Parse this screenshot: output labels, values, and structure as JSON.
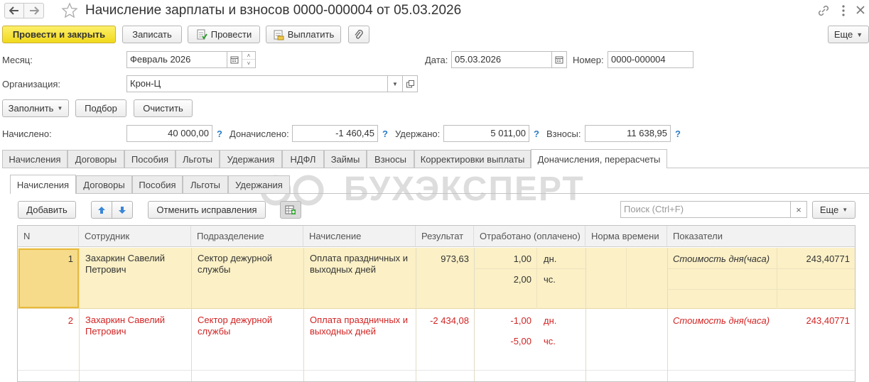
{
  "window": {
    "title": "Начисление зарплаты и взносов 0000-000004 от 05.03.2026",
    "icons": [
      "back-arrow-icon",
      "forward-arrow-icon",
      "star-icon",
      "link-icon",
      "menu-icon",
      "close-icon"
    ]
  },
  "toolbar": {
    "post_close": "Провести и закрыть",
    "save": "Записать",
    "post": "Провести",
    "pay": "Выплатить",
    "more": "Еще"
  },
  "form": {
    "month_label": "Месяц:",
    "month_value": "Февраль 2026",
    "date_label": "Дата:",
    "date_value": "05.03.2026",
    "number_label": "Номер:",
    "number_value": "0000-000004",
    "org_label": "Организация:",
    "org_value": "Крон-Ц",
    "fill": "Заполнить",
    "pick": "Подбор",
    "clear": "Очистить"
  },
  "totals": {
    "accrued_label": "Начислено:",
    "accrued_value": "40 000,00",
    "additional_label": "Доначислено:",
    "additional_value": "-1 460,45",
    "withheld_label": "Удержано:",
    "withheld_value": "5 011,00",
    "contrib_label": "Взносы:",
    "contrib_value": "11 638,95",
    "help": "?"
  },
  "tabs": [
    "Начисления",
    "Договоры",
    "Пособия",
    "Льготы",
    "Удержания",
    "НДФЛ",
    "Займы",
    "Взносы",
    "Корректировки выплаты",
    "Доначисления, перерасчеты"
  ],
  "subtabs": [
    "Начисления",
    "Договоры",
    "Пособия",
    "Льготы",
    "Удержания"
  ],
  "watermark": "БУХЭКСПЕРТ",
  "subtoolbar": {
    "add": "Добавить",
    "cancel_corrections": "Отменить исправления",
    "search_placeholder": "Поиск (Ctrl+F)",
    "search_clear": "×",
    "more": "Еще"
  },
  "table": {
    "columns": [
      "N",
      "Сотрудник",
      "Подразделение",
      "Начисление",
      "Результат",
      "Отработано (оплачено)",
      "Норма времени",
      "Показатели"
    ],
    "rows": [
      {
        "n": "1",
        "employee": "Захаркин Савелий Петрович",
        "department": "Сектор дежурной службы",
        "accrual": "Оплата праздничных и выходных дней",
        "result": "973,63",
        "worked_days": "1,00",
        "days_unit": "дн.",
        "worked_hours": "2,00",
        "hours_unit": "чс.",
        "indicator": "Стоимость дня(часа)",
        "indicator_value": "243,40771"
      },
      {
        "n": "2",
        "employee": "Захаркин Савелий Петрович",
        "department": "Сектор дежурной службы",
        "accrual": "Оплата праздничных и выходных дней",
        "result": "-2 434,08",
        "worked_days": "-1,00",
        "days_unit": "дн.",
        "worked_hours": "-5,00",
        "hours_unit": "чс.",
        "indicator": "Стоимость дня(часа)",
        "indicator_value": "243,40771"
      }
    ]
  },
  "colors": {
    "primary_button": "#f4dc2a",
    "selected_row": "#fbf0c6",
    "current_cell": "#f6dc8a",
    "negative_text": "#d22323",
    "help_icon": "#2b7cc9"
  }
}
